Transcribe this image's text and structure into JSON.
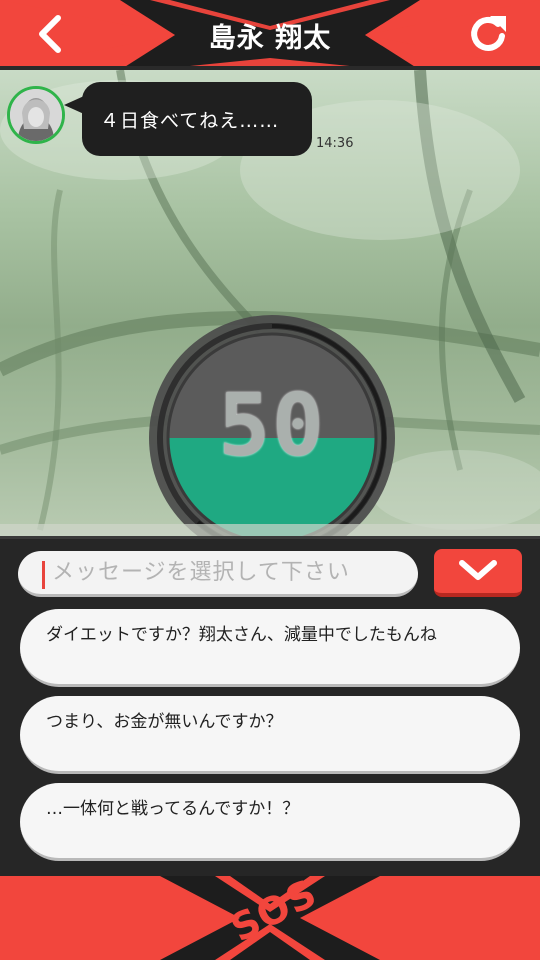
{
  "header": {
    "title": "島永 翔太",
    "back_icon": "chevron-left-icon",
    "refresh_icon": "refresh-icon",
    "accent_color": "#f2463d"
  },
  "chat": {
    "messages": [
      {
        "sender_avatar": "avatar-icon",
        "text": "４日食べてねえ……",
        "time": "14:36"
      }
    ]
  },
  "timer": {
    "value": "50",
    "fill_fraction": 0.5,
    "fill_color": "#1fa982"
  },
  "reply": {
    "placeholder": "メッセージを選択して下さい",
    "dropdown_icon": "chevron-down-icon",
    "options": [
      "ダイエットですか？翔太さん、減量中でしたもんね",
      "つまり、お金が無いんですか？",
      "…一体何と戦ってるんですか！？"
    ]
  },
  "footer": {
    "sos_label": "SOS"
  }
}
